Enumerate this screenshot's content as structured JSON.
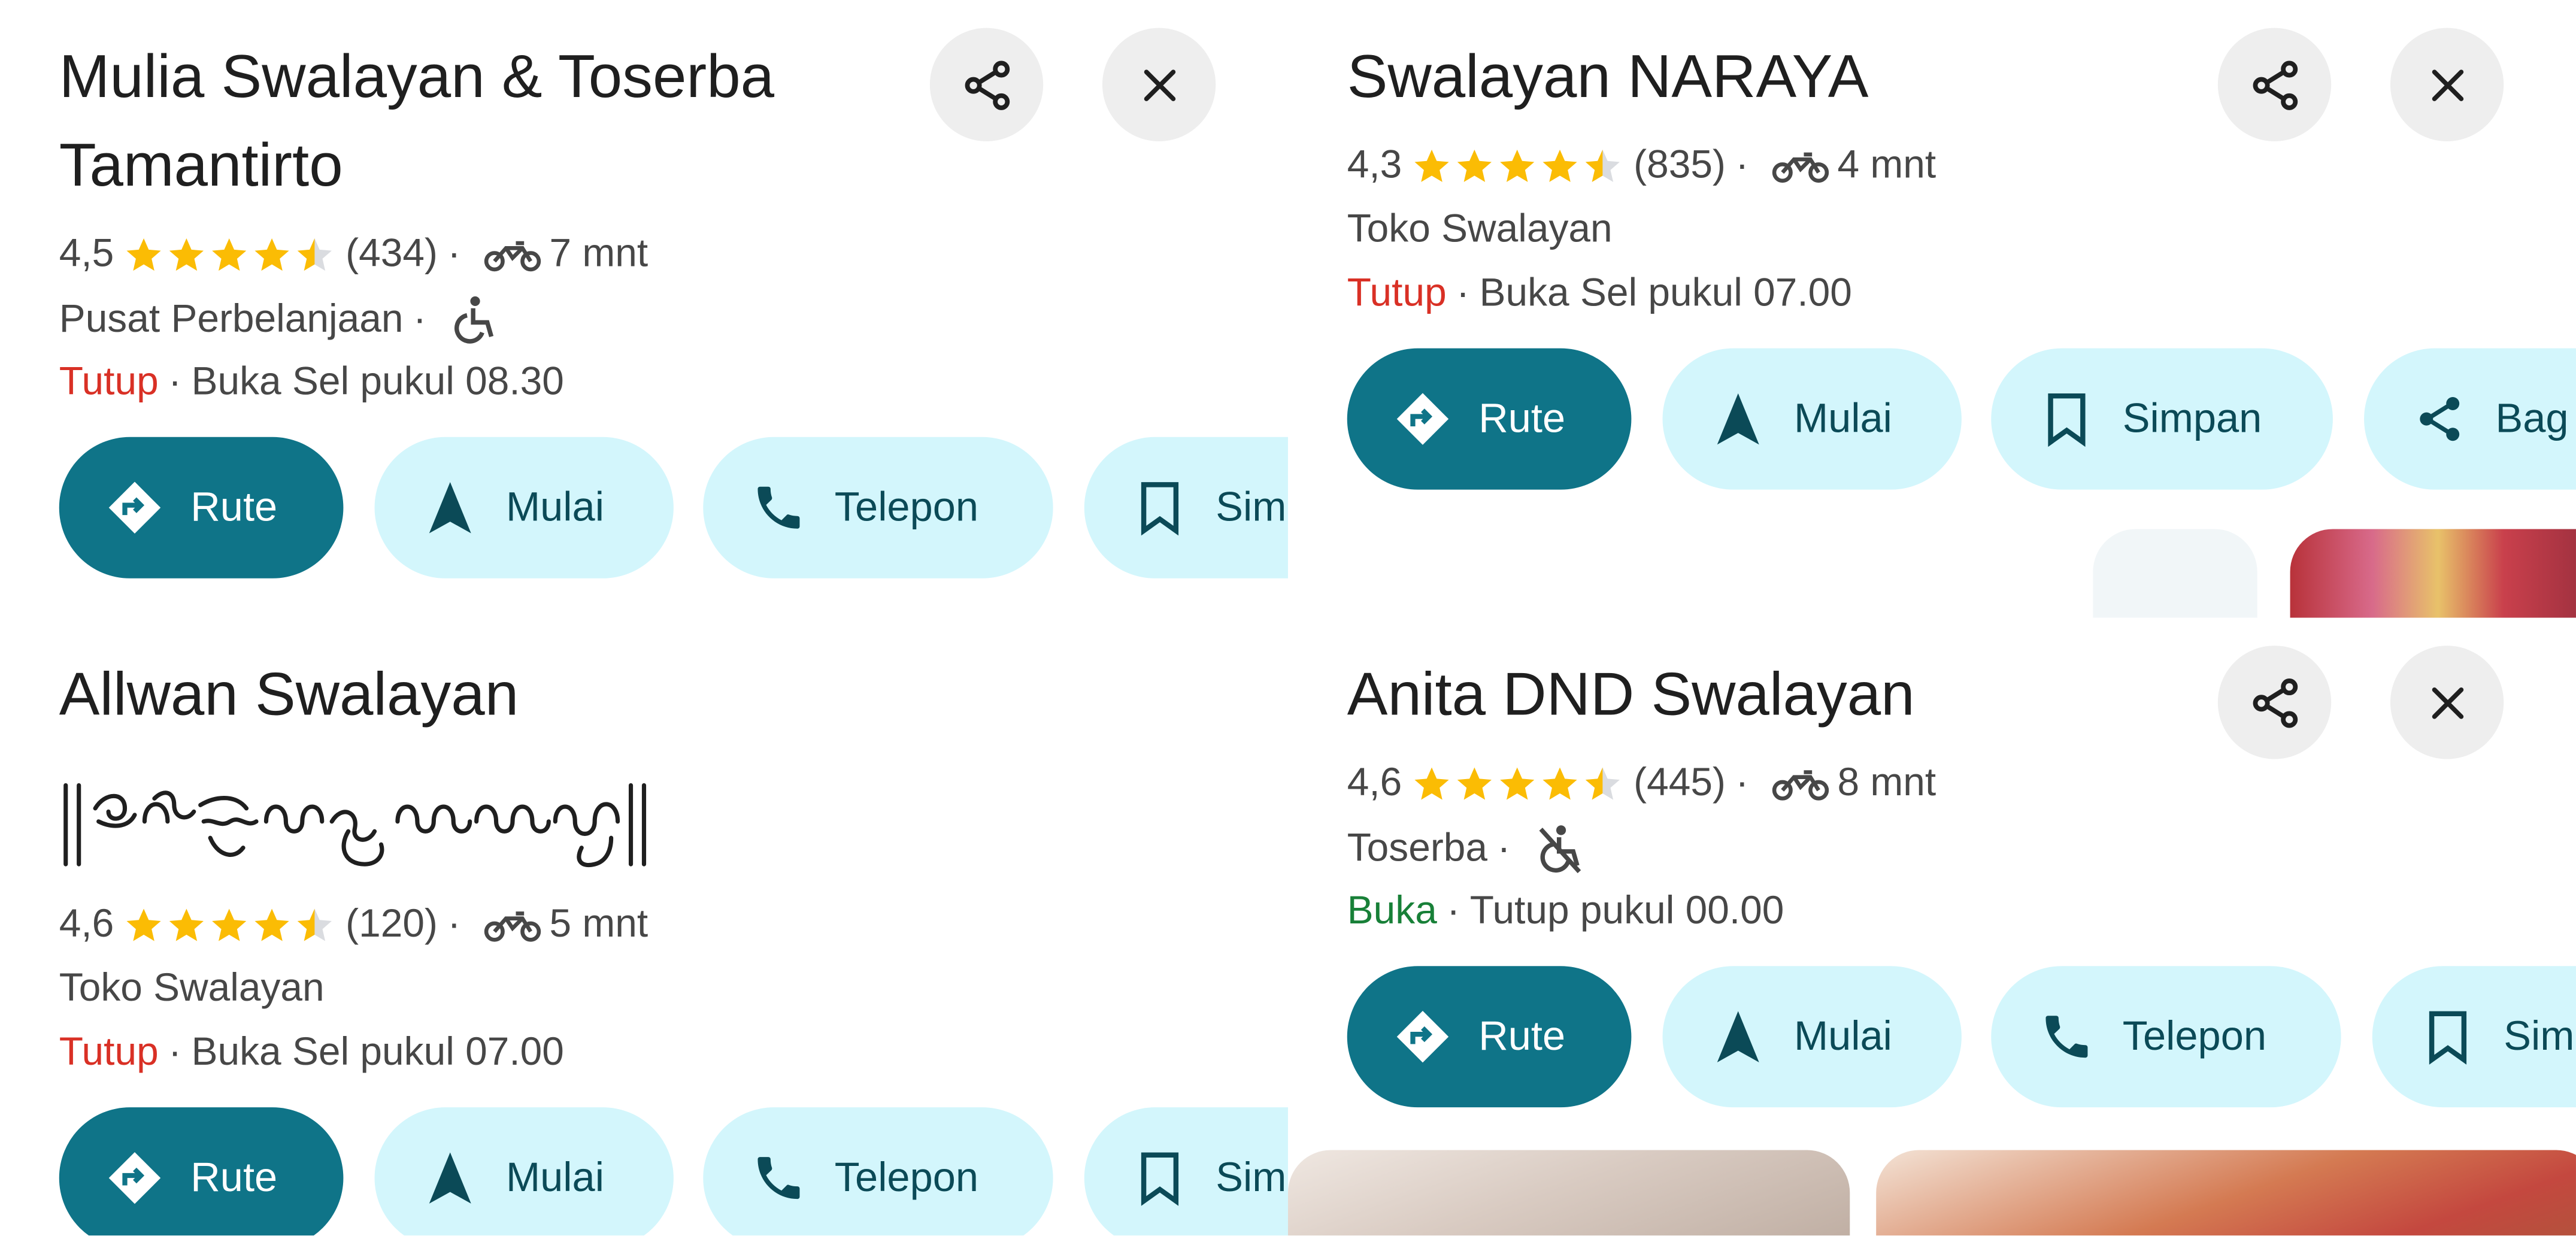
{
  "colors": {
    "primary_chip": "#0f7488",
    "secondary_chip": "#d3f6fc",
    "closed": "#d93025",
    "open": "#188038",
    "star": "#fbbc04"
  },
  "cards": [
    {
      "title_line1": "Mulia Swalayan & Toserba",
      "title_line2": "Tamantirto",
      "rating": "4,5",
      "stars": 4.5,
      "reviews": "(434)",
      "travel_time": "7 mnt",
      "category": "Pusat Perbelanjaan",
      "accessibility_icon": "wheelchair-icon",
      "status": "Tutup",
      "status_detail": "Buka Sel pukul 08.30",
      "chips": [
        "Rute",
        "Mulai",
        "Telepon",
        "Sim"
      ]
    },
    {
      "title_line1": "Swalayan NARAYA",
      "rating": "4,3",
      "stars": 4.5,
      "reviews": "(835)",
      "travel_time": "4 mnt",
      "category": "Toko Swalayan",
      "status": "Tutup",
      "status_detail": "Buka Sel pukul 07.00",
      "chips": [
        "Rute",
        "Mulai",
        "Simpan",
        "Bag"
      ]
    },
    {
      "title_line1": "Allwan Swalayan",
      "rating": "4,6",
      "stars": 4.5,
      "reviews": "(120)",
      "travel_time": "5 mnt",
      "category": "Toko Swalayan",
      "status": "Tutup",
      "status_detail": "Buka Sel pukul 07.00",
      "chips": [
        "Rute",
        "Mulai",
        "Telepon",
        "Sim"
      ]
    },
    {
      "title_line1": "Anita DND Swalayan",
      "rating": "4,6",
      "stars": 4.5,
      "reviews": "(445)",
      "travel_time": "8 mnt",
      "category": "Toserba",
      "accessibility_icon": "no-wheelchair-icon",
      "status": "Buka",
      "status_detail": "Tutup pukul 00.00",
      "chips": [
        "Rute",
        "Mulai",
        "Telepon",
        "Sim"
      ]
    }
  ],
  "separator": "·"
}
